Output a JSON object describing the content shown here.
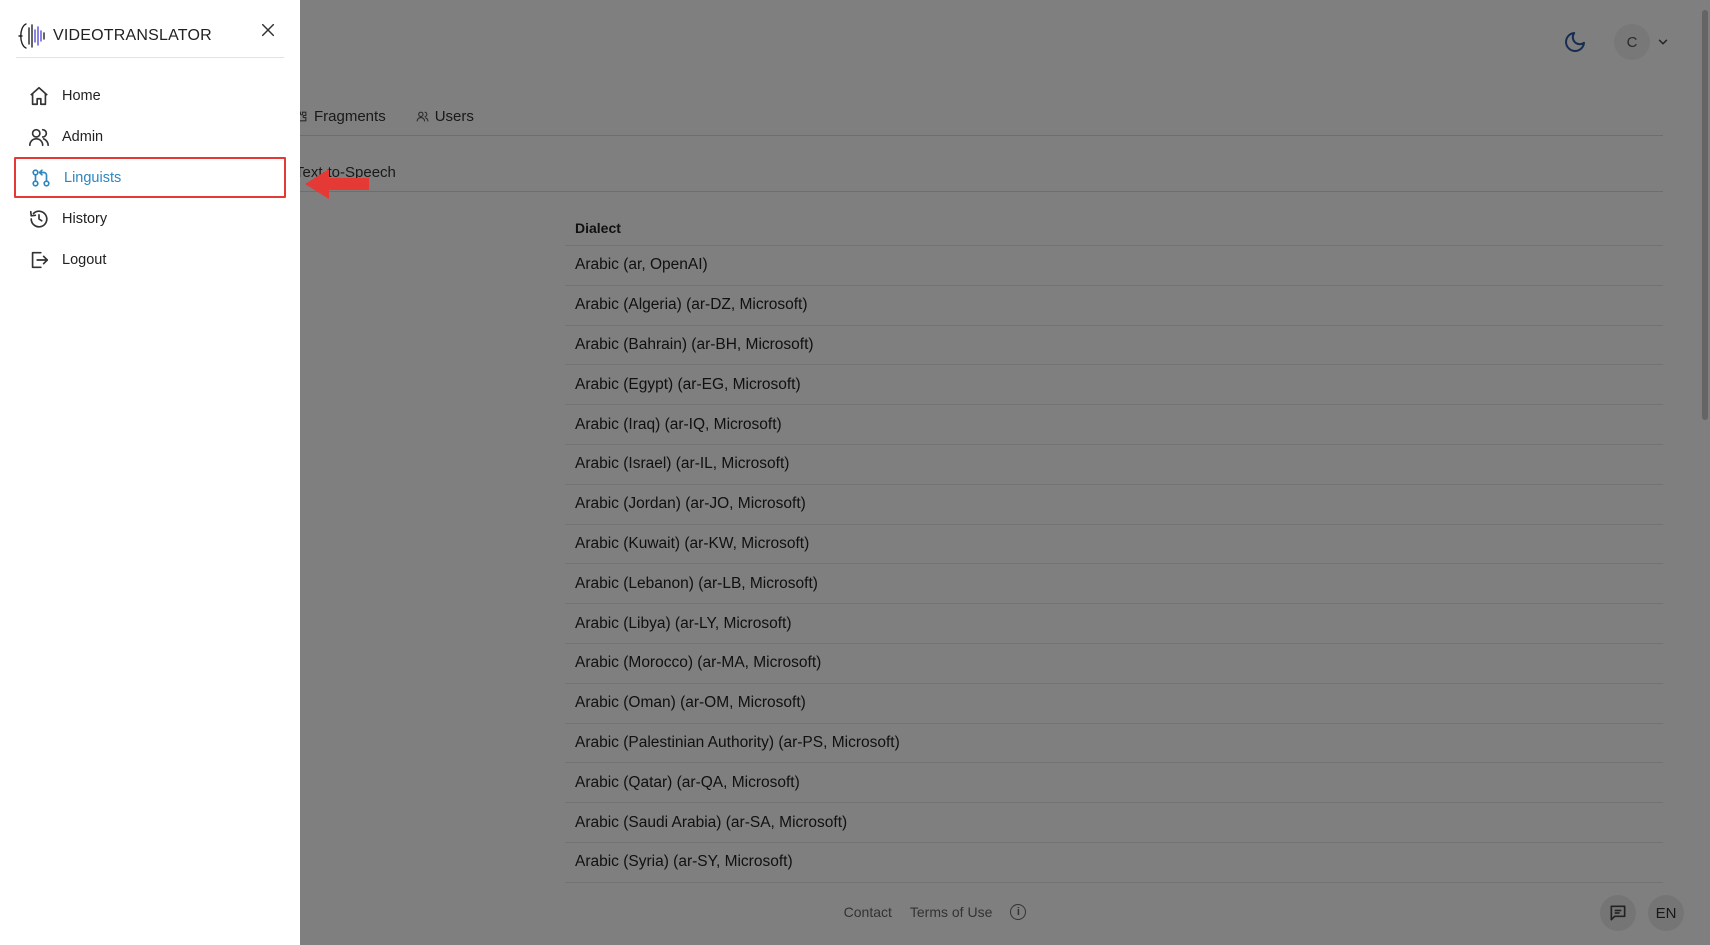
{
  "app": {
    "brand": "VIDEOTRANSLATOR"
  },
  "header": {
    "user_initial": "C"
  },
  "tabs": [
    {
      "label": "Fragments"
    },
    {
      "label": "Users"
    }
  ],
  "subtabs": [
    {
      "label": "Text-to-Speech"
    }
  ],
  "table": {
    "column_header": "Dialect",
    "rows": [
      "Arabic (ar, OpenAI)",
      "Arabic (Algeria) (ar-DZ, Microsoft)",
      "Arabic (Bahrain) (ar-BH, Microsoft)",
      "Arabic (Egypt) (ar-EG, Microsoft)",
      "Arabic (Iraq) (ar-IQ, Microsoft)",
      "Arabic (Israel) (ar-IL, Microsoft)",
      "Arabic (Jordan) (ar-JO, Microsoft)",
      "Arabic (Kuwait) (ar-KW, Microsoft)",
      "Arabic (Lebanon) (ar-LB, Microsoft)",
      "Arabic (Libya) (ar-LY, Microsoft)",
      "Arabic (Morocco) (ar-MA, Microsoft)",
      "Arabic (Oman) (ar-OM, Microsoft)",
      "Arabic (Palestinian Authority) (ar-PS, Microsoft)",
      "Arabic (Qatar) (ar-QA, Microsoft)",
      "Arabic (Saudi Arabia) (ar-SA, Microsoft)",
      "Arabic (Syria) (ar-SY, Microsoft)"
    ]
  },
  "footer": {
    "contact": "Contact",
    "terms": "Terms of Use"
  },
  "bottom_right": {
    "language": "EN"
  },
  "drawer": {
    "nav": [
      {
        "label": "Home",
        "icon": "home-icon"
      },
      {
        "label": "Admin",
        "icon": "users-icon"
      },
      {
        "label": "Linguists",
        "icon": "linguists-icon",
        "active": true
      },
      {
        "label": "History",
        "icon": "history-icon"
      },
      {
        "label": "Logout",
        "icon": "logout-icon"
      }
    ]
  },
  "colors": {
    "accent": "#2e86c1",
    "highlight_border": "#e53935",
    "arrow": "#e53935",
    "moon_icon": "#2c5aa0",
    "overlay": "rgba(0,0,0,0.5)"
  }
}
